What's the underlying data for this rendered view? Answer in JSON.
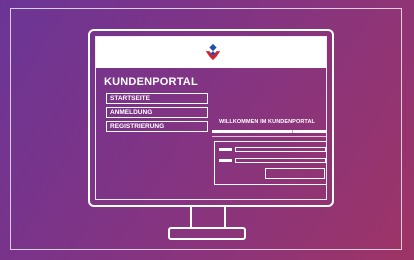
{
  "portal": {
    "title": "KUNDENPORTAL",
    "nav": [
      "STARTSEITE",
      "ANMELDUNG",
      "REGISTRIERUNG"
    ],
    "welcome": "WILLKOMMEN IM KUNDENPORTAL"
  },
  "colors": {
    "background_start": "#6b3596",
    "background_end": "#9e3466",
    "logo_blue": "#1f4fa8",
    "logo_red": "#d4232f",
    "line": "#ffffff"
  },
  "icons": {
    "logo": "company-logo-icon",
    "monitor": "monitor-outline"
  }
}
